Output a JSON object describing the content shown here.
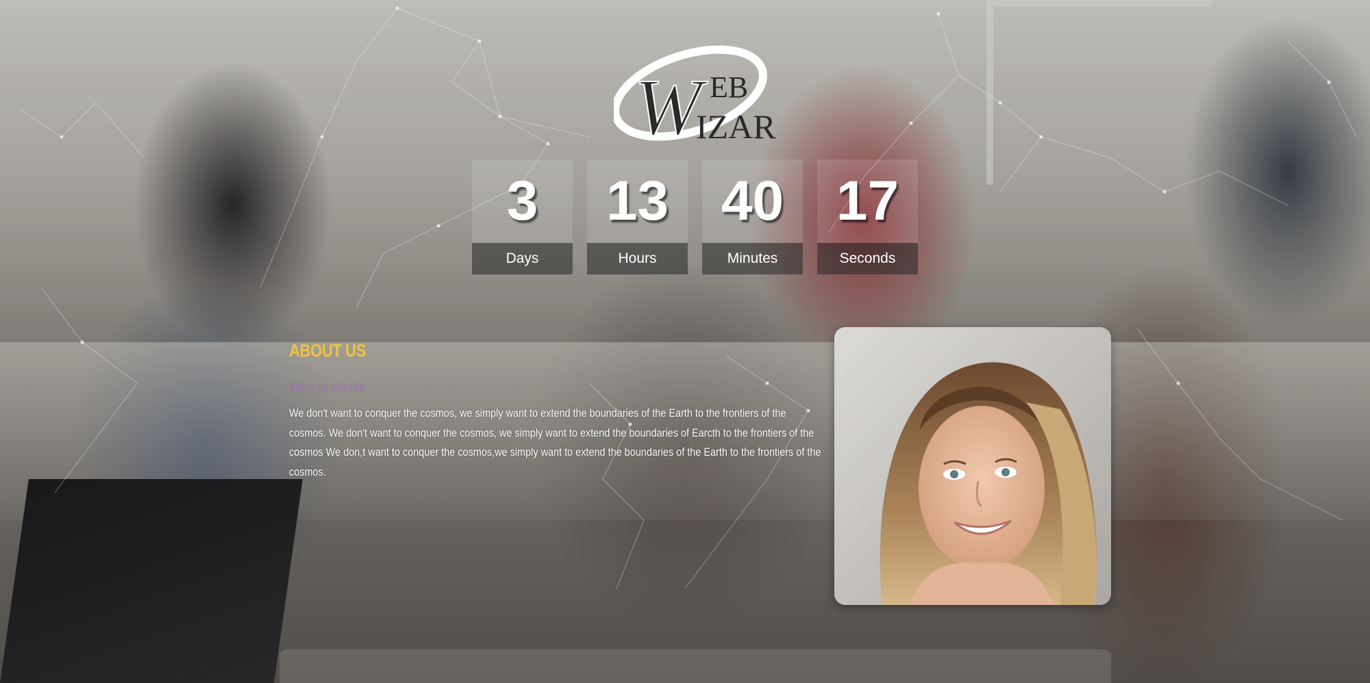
{
  "brand": {
    "logo_letters_big": "W",
    "logo_letters_top": "EB",
    "logo_letters_bottom": "IZAR"
  },
  "countdown": {
    "days": {
      "value": "3",
      "label": "Days"
    },
    "hours": {
      "value": "13",
      "label": "Hours"
    },
    "minutes": {
      "value": "40",
      "label": "Minutes"
    },
    "seconds": {
      "value": "17",
      "label": "Seconds"
    }
  },
  "about": {
    "title": "ABOUT US",
    "subtitle": "About us sub title",
    "text": "We don't want to conquer the cosmos, we simply want to extend the boundaries of the Earth to the frontiers of the cosmos. We don't want to conquer the cosmos, we simply want to extend the boundaries of Earcth to the frontiers of the cosmos We don,t want to conquer the cosmos,we simply want to extend the boundaries of the Earth to the frontiers of the cosmos."
  },
  "colors": {
    "accent_title": "#f2c23a",
    "subtitle": "#9a6fb0",
    "text": "#ffffff"
  }
}
